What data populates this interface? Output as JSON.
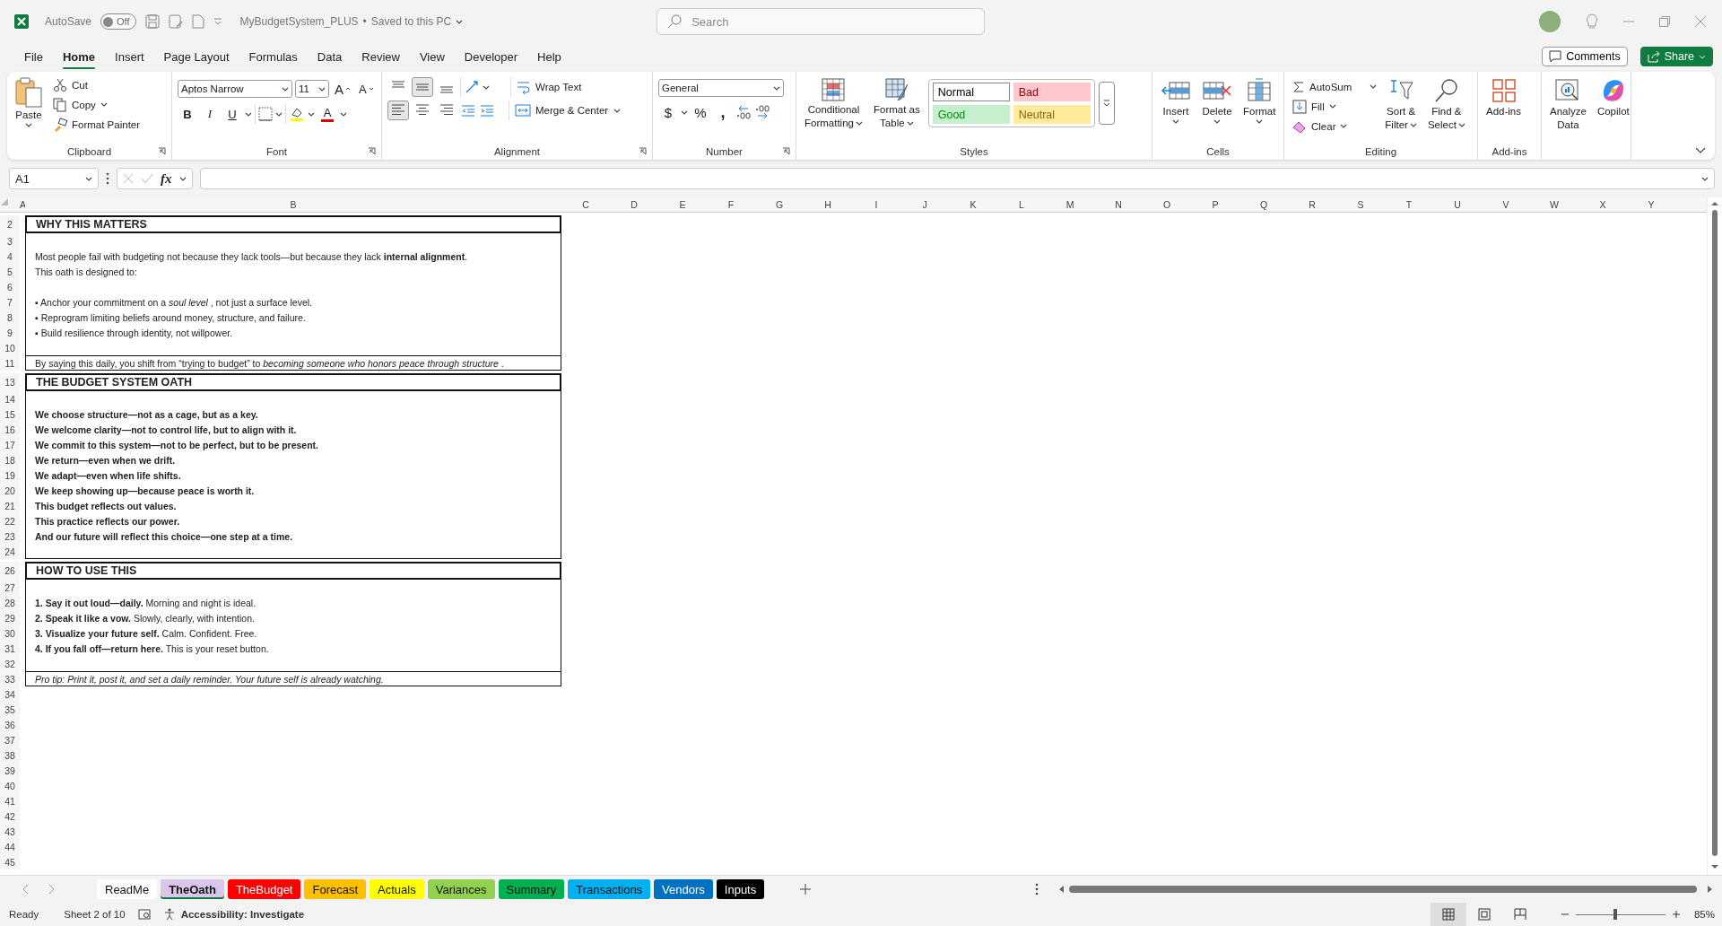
{
  "title_bar": {
    "autosave_label": "AutoSave",
    "autosave": {
      "on": false,
      "label": "Off"
    },
    "document": "MyBudgetSystem_PLUS",
    "separator": "•",
    "save_status": "Saved to this PC",
    "search": {
      "placeholder": "Search"
    }
  },
  "menu_tabs": [
    {
      "label": "File",
      "selected": false
    },
    {
      "label": "Home",
      "selected": true
    },
    {
      "label": "Insert",
      "selected": false
    },
    {
      "label": "Page Layout",
      "selected": false
    },
    {
      "label": "Formulas",
      "selected": false
    },
    {
      "label": "Data",
      "selected": false
    },
    {
      "label": "Review",
      "selected": false
    },
    {
      "label": "View",
      "selected": false
    },
    {
      "label": "Developer",
      "selected": false
    },
    {
      "label": "Help",
      "selected": false
    }
  ],
  "header_buttons": {
    "comments": "Comments",
    "share": "Share"
  },
  "ribbon": {
    "groups": [
      {
        "kind": "clipboard",
        "label": "Clipboard",
        "paste": "Paste",
        "items": [
          "Cut",
          "Copy",
          "Format Painter"
        ]
      },
      {
        "kind": "font",
        "label": "Font",
        "font": "Aptos Narrow",
        "size": "11",
        "size_buttons": [
          "A",
          "A"
        ],
        "style_buttons": [
          "B",
          "I",
          "U"
        ],
        "color_button": "A"
      },
      {
        "kind": "alignment",
        "label": "Alignment",
        "items": [
          "Wrap Text",
          "Merge & Center"
        ],
        "align_buttons": [
          {
            "selected": false
          },
          {
            "selected": true
          },
          {
            "selected": false
          },
          {
            "selected": true
          },
          {
            "selected": false
          },
          {
            "selected": false
          }
        ]
      },
      {
        "kind": "number",
        "label": "Number",
        "format": "General",
        "symbols": [
          "$",
          "%",
          ","
        ]
      },
      {
        "kind": "styles",
        "label": "Styles",
        "buttons": [
          [
            "Conditional",
            "Formatting"
          ],
          [
            "Format as",
            "Table"
          ]
        ],
        "cell_styles": [
          {
            "label": "Normal",
            "color": "#ffffff"
          },
          {
            "label": "Bad",
            "color": "#ffc7ce"
          },
          {
            "label": "Good",
            "color": "#c6efce"
          },
          {
            "label": "Neutral",
            "color": "#ffeb9c"
          }
        ]
      },
      {
        "kind": "cells",
        "label": "Cells",
        "buttons": [
          [
            "Insert"
          ],
          [
            "Delete"
          ],
          [
            "Format"
          ]
        ]
      },
      {
        "kind": "editing",
        "label": "Editing",
        "items": [
          "AutoSum",
          "Fill",
          "Clear"
        ],
        "buttons": [
          [
            "Sort &",
            "Filter"
          ],
          [
            "Find &",
            "Select"
          ]
        ]
      },
      {
        "kind": "addins",
        "label": "Add-ins",
        "buttons": [
          [
            "Add-ins"
          ]
        ]
      },
      {
        "kind": "tools",
        "buttons": [
          [
            "Analyze",
            "Data"
          ],
          [
            "Copilot"
          ]
        ]
      }
    ]
  },
  "formula_bar": {
    "name_box": "A1",
    "function_label": "fx"
  },
  "sheet": {
    "columns": [
      "A",
      "B",
      "C",
      "D",
      "E",
      "F",
      "G",
      "H",
      "I",
      "J",
      "K",
      "L",
      "M",
      "N",
      "O",
      "P",
      "Q",
      "R",
      "S",
      "T",
      "U",
      "V",
      "W",
      "X",
      "Y"
    ],
    "rows": [
      {
        "number": "2",
        "kind": "title",
        "text": "WHY THIS MATTERS"
      },
      {
        "number": "3",
        "kind": "body"
      },
      {
        "number": "4",
        "kind": "body",
        "text": "Most people fail with budgeting not because they lack tools—but because they lack **internal alignment**."
      },
      {
        "number": "5",
        "kind": "body",
        "text": "This oath is designed to:"
      },
      {
        "number": "6",
        "kind": "body"
      },
      {
        "number": "7",
        "kind": "body",
        "text": "▪ Anchor your commitment on a *soul level* , not just a surface level."
      },
      {
        "number": "8",
        "kind": "body",
        "text": "▪ Reprogram limiting beliefs around money, structure, and failure."
      },
      {
        "number": "9",
        "kind": "body",
        "text": "▪ Build resilience through identity, not willpower."
      },
      {
        "number": "10",
        "kind": "body"
      },
      {
        "number": "11",
        "kind": "footer",
        "text": "By saying this daily, you shift from “trying to budget” to *becoming someone who honors peace through structure* ."
      },
      {
        "number": "13",
        "kind": "title",
        "text": "THE BUDGET SYSTEM OATH"
      },
      {
        "number": "14",
        "kind": "body"
      },
      {
        "number": "15",
        "kind": "body",
        "bold": true,
        "text": "We choose structure—not as a cage, but as a key."
      },
      {
        "number": "16",
        "kind": "body",
        "bold": true,
        "text": "We welcome clarity—not to control life, but to align with it."
      },
      {
        "number": "17",
        "kind": "body",
        "bold": true,
        "text": "We commit to this system—not to be perfect, but to be present."
      },
      {
        "number": "18",
        "kind": "body",
        "bold": true,
        "text": "We return—even when we drift."
      },
      {
        "number": "19",
        "kind": "body",
        "bold": true,
        "text": "We adapt—even when life shifts."
      },
      {
        "number": "20",
        "kind": "body",
        "bold": true,
        "text": "We keep showing up—because peace is worth it."
      },
      {
        "number": "21",
        "kind": "body",
        "bold": true,
        "text": "This budget reflects out values."
      },
      {
        "number": "22",
        "kind": "body",
        "bold": true,
        "text": "This practice reflects our power."
      },
      {
        "number": "23",
        "kind": "body",
        "bold": true,
        "text": "And our future will reflect this choice—one step at a time."
      },
      {
        "number": "24",
        "kind": "end"
      },
      {
        "number": "26",
        "kind": "title",
        "text": "HOW TO USE THIS"
      },
      {
        "number": "27",
        "kind": "body"
      },
      {
        "number": "28",
        "kind": "body",
        "text": "**1. Say it out loud—daily.** Morning and night is ideal."
      },
      {
        "number": "29",
        "kind": "body",
        "text": "**2. Speak it like a vow.** Slowly, clearly, with intention."
      },
      {
        "number": "30",
        "kind": "body",
        "text": "**3. Visualize your future self.** Calm. Confident. Free."
      },
      {
        "number": "31",
        "kind": "body",
        "text": "**4. If you fall off—return here.** This is your reset button."
      },
      {
        "number": "32",
        "kind": "body"
      },
      {
        "number": "33",
        "kind": "footer",
        "italic": true,
        "text": "Pro tip: Print it, post it, and set a daily reminder. Your future self is already watching."
      },
      {
        "number": "34",
        "kind": "empty"
      },
      {
        "number": "35",
        "kind": "empty"
      },
      {
        "number": "36",
        "kind": "empty"
      },
      {
        "number": "37",
        "kind": "empty"
      },
      {
        "number": "38",
        "kind": "empty"
      },
      {
        "number": "39",
        "kind": "empty"
      },
      {
        "number": "40",
        "kind": "empty"
      },
      {
        "number": "41",
        "kind": "empty"
      },
      {
        "number": "42",
        "kind": "empty"
      },
      {
        "number": "43",
        "kind": "empty"
      },
      {
        "number": "44",
        "kind": "empty"
      },
      {
        "number": "45",
        "kind": "empty"
      }
    ]
  },
  "sheet_tabs": [
    {
      "label": "ReadMe",
      "color": "#ffffff",
      "selected": false
    },
    {
      "label": "TheOath",
      "color": "#d9c6ea",
      "selected": true
    },
    {
      "label": "TheBudget",
      "color": "#ff0000",
      "selected": false
    },
    {
      "label": "Forecast",
      "color": "#ffc000",
      "selected": false
    },
    {
      "label": "Actuals",
      "color": "#ffff00",
      "selected": false
    },
    {
      "label": "Variances",
      "color": "#92d050",
      "selected": false
    },
    {
      "label": "Summary",
      "color": "#00b050",
      "selected": false
    },
    {
      "label": "Transactions",
      "color": "#00b0f0",
      "selected": false
    },
    {
      "label": "Vendors",
      "color": "#0070c0",
      "selected": false
    },
    {
      "label": "Inputs",
      "color": "#000000",
      "selected": false
    }
  ],
  "status_bar": {
    "mode": "Ready",
    "sheet_position": "Sheet 2 of 10",
    "accessibility": "Accessibility: Investigate",
    "views": [
      {
        "selected": true
      },
      {
        "selected": false
      },
      {
        "selected": false
      }
    ],
    "zoom": {
      "level": 0.42,
      "reading": "85%"
    }
  }
}
